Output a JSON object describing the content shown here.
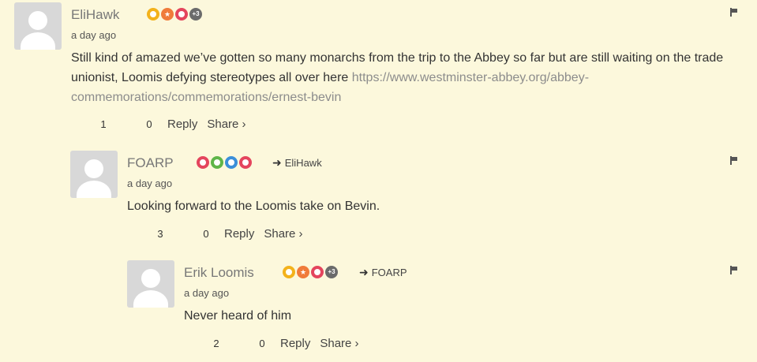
{
  "comments": [
    {
      "author": "EliHawk",
      "time": "a day ago",
      "text": "Still kind of amazed we’ve gotten so many monarchs from the trip to the Abbey so far but are still waiting on the trade unionist, Loomis defying stereotypes all over here ",
      "link": "https://www.westminster-abbey.org/abbey-commemorations/commemorations/ernest-bevin",
      "link_line1": "https://www.westminster-abbey.org/abbey-",
      "link_line2": "commemorations/commemorations/ernest-bevin",
      "upvotes": "1",
      "downvotes": "0",
      "reply_label": "Reply",
      "share_label": "Share ›",
      "badges": [
        {
          "icon": "trophy-icon",
          "color": "#f3b21b"
        },
        {
          "icon": "star-icon",
          "color": "#f07b3a"
        },
        {
          "icon": "heart-icon",
          "color": "#e4455d"
        }
      ],
      "more_badges": "+3",
      "reply_to": ""
    },
    {
      "author": "FOARP",
      "time": "a day ago",
      "text": "Looking forward to the Loomis take on Bevin.",
      "upvotes": "3",
      "downvotes": "0",
      "reply_label": "Reply",
      "share_label": "Share ›",
      "badges": [
        {
          "icon": "heart-icon",
          "color": "#e4455d"
        },
        {
          "icon": "smile-icon",
          "color": "#5fb548"
        },
        {
          "icon": "chat-icon",
          "color": "#3b8fd9"
        },
        {
          "icon": "heart-icon",
          "color": "#e4455d"
        }
      ],
      "reply_to": "EliHawk"
    },
    {
      "author": "Erik Loomis",
      "time": "a day ago",
      "text": "Never heard of him",
      "upvotes": "2",
      "downvotes": "0",
      "reply_label": "Reply",
      "share_label": "Share ›",
      "badges": [
        {
          "icon": "trophy-icon",
          "color": "#f3b21b"
        },
        {
          "icon": "star-icon",
          "color": "#f07b3a"
        },
        {
          "icon": "heart-icon",
          "color": "#e4455d"
        }
      ],
      "more_badges": "+3",
      "reply_to": "FOARP"
    }
  ]
}
